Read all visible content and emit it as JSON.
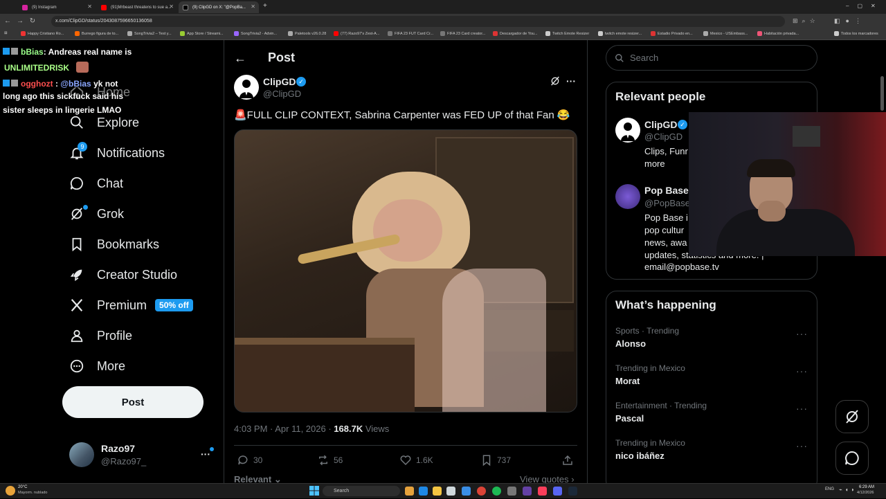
{
  "browser": {
    "tabs": [
      {
        "label": "(9) Instagram"
      },
      {
        "label": "(91)Mrbeast threatens to sue a..."
      },
      {
        "label": "(9) ClipGD on X: \"@PopBa..."
      }
    ],
    "url": "x.com/ClipGD/status/2043087596650136058",
    "bookmarks": [
      "Happy Cristiano Ro...",
      "Burrego figura de to...",
      "SongTrivia2 – Test y...",
      "App Store / Streami...",
      "SongTrivia2 - Advin...",
      "Paletools v26.0.28",
      "(77) Razo97's Zest-A...",
      "FIFA 23 FUT Card Cr...",
      "FIFA 23 Card creator...",
      "Descargador de You...",
      "Twitch Emote Resizer",
      "twitch emote resizer...",
      "Estadio Privado en...",
      "Mexico - USEmbass...",
      "Habitación privada..."
    ],
    "bookmarks_folder": "Todos los marcadores"
  },
  "chat": [
    {
      "user": "bBias",
      "text": ": Andreas real name is"
    },
    {
      "text": "UNLIMITEDRISK"
    },
    {
      "user": "ogghozt",
      "mention": "@bBias",
      "text": "yk not"
    },
    {
      "text": "long ago this sickfuck said his"
    },
    {
      "text": "sister sleeps in lingerie LMAO"
    }
  ],
  "nav": {
    "home": "Home",
    "explore": "Explore",
    "notifications": "Notifications",
    "notif_count": "9",
    "chat": "Chat",
    "grok": "Grok",
    "bookmarks": "Bookmarks",
    "creator": "Creator Studio",
    "premium": "Premium",
    "premium_badge": "50% off",
    "profile": "Profile",
    "more": "More",
    "post": "Post",
    "account_name": "Razo97",
    "account_handle": "@Razo97_"
  },
  "post": {
    "header": "Post",
    "author": "ClipGD",
    "handle": "@ClipGD",
    "text": "🚨FULL CLIP CONTEXT, Sabrina Carpenter was FED UP of that Fan 😂",
    "time": "4:03 PM · Apr 11, 2026 · ",
    "views_count": "168.7K",
    "views_label": " Views",
    "replies": "30",
    "reposts": "56",
    "likes": "1.6K",
    "bookmarks": "737",
    "relevant": "Relevant",
    "view_quotes": "View quotes"
  },
  "sidebar": {
    "search_placeholder": "Search",
    "people_title": "Relevant people",
    "people": [
      {
        "name": "ClipGD",
        "handle": "@ClipGD",
        "bio1": "Clips, Funr",
        "bio2": "more"
      },
      {
        "name": "Pop Base",
        "handle": "@PopBase",
        "bio1": "Pop Base i",
        "bio2": "pop cultur",
        "bio3": "news, awa",
        "bio4": "updates, statistics and more. |",
        "bio5": "email@popbase.tv"
      }
    ],
    "happening_title": "What’s happening",
    "trends": [
      {
        "category": "Sports · Trending",
        "name": "Alonso"
      },
      {
        "category": "Trending in Mexico",
        "name": "Morat"
      },
      {
        "category": "Entertainment · Trending",
        "name": "Pascal"
      },
      {
        "category": "Trending in Mexico",
        "name": "nico ibáñez"
      }
    ]
  },
  "taskbar": {
    "temp": "20°C",
    "weather": "Mayorm. nublado",
    "search": "Search",
    "lang": "ENG",
    "time": "6:29 AM",
    "date": "4/12/2026"
  },
  "colors": {
    "accent": "#1d9bf0",
    "bg": "#000000",
    "muted": "#71767b"
  }
}
